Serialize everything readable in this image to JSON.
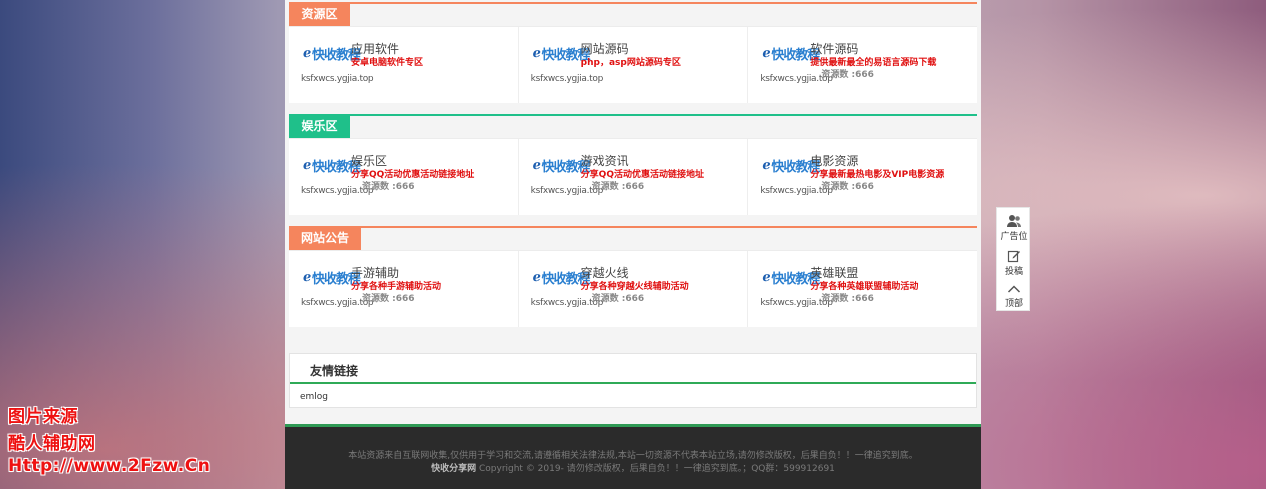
{
  "colors": {
    "orange": "#f5855d",
    "green": "#1fc08a",
    "footer_green": "#2f9a55"
  },
  "logo": {
    "top": "快收教程",
    "bottom": "ksfxwcs.ygjia.top"
  },
  "sections": [
    {
      "title": "资源区",
      "cells": [
        {
          "title": "应用软件",
          "desc": "安卓电脑软件专区",
          "count": ""
        },
        {
          "title": "网站源码",
          "desc": "php，asp网站源码专区",
          "count": ""
        },
        {
          "title": "软件源码",
          "desc": "提供最新最全的易语言源码下载",
          "count": "资源数 :666"
        }
      ]
    },
    {
      "title": "娱乐区",
      "cells": [
        {
          "title": "娱乐区",
          "desc": "分享QQ活动优惠活动链接地址",
          "count": "资源数 :666"
        },
        {
          "title": "游戏资讯",
          "desc": "分享QQ活动优惠活动链接地址",
          "count": "资源数 :666"
        },
        {
          "title": "电影资源",
          "desc": "分享最新最热电影及VIP电影资源",
          "count": "资源数 :666"
        }
      ]
    },
    {
      "title": "网站公告",
      "cells": [
        {
          "title": "手游辅助",
          "desc": "分享各种手游辅助活动",
          "count": "资源数 :666"
        },
        {
          "title": "穿越火线",
          "desc": "分享各种穿越火线辅助活动",
          "count": "资源数 :666"
        },
        {
          "title": "英雄联盟",
          "desc": "分享各种英雄联盟辅助活动",
          "count": "资源数 :666"
        }
      ]
    }
  ],
  "friend_links": {
    "title": "友情链接",
    "items": [
      "emlog"
    ]
  },
  "footer": {
    "line1": "本站资源来自互联网收集,仅供用于学习和交流,请遵循相关法律法规,本站一切资源不代表本站立场,请勿修改版权，后果自负！！一律追究到底。",
    "site_name": "快收分享网",
    "line2": "Copyright © 2019- 请勿修改版权，后果自负！！一律追究到底。；QQ群：599912691"
  },
  "sidebar": {
    "ad": "广告位",
    "submit": "投稿",
    "top": "顶部"
  },
  "watermark": {
    "line1": "图片来源",
    "line2": "酷人辅助网",
    "line3": "Http://www.2Fzw.Cn"
  }
}
